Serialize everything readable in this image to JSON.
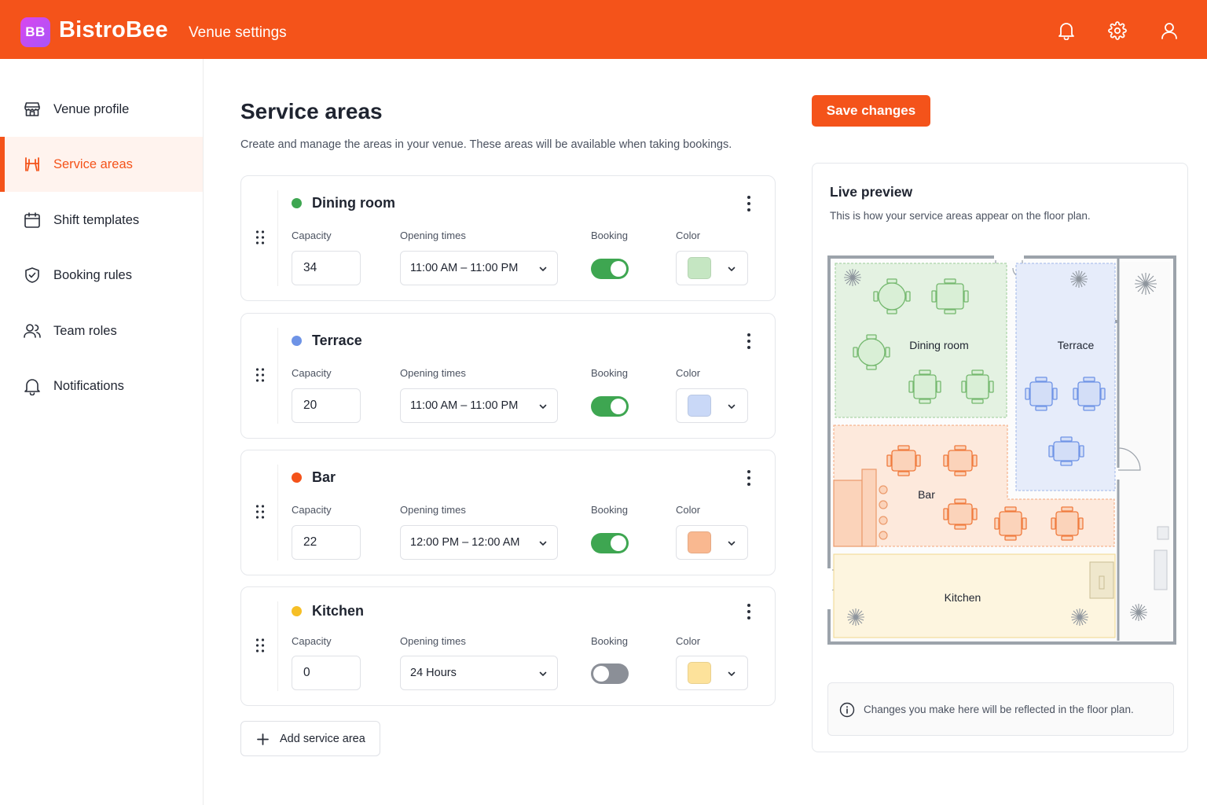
{
  "header": {
    "logo_text": "BB",
    "brand": "BistroBee",
    "section": "Venue settings",
    "icons": [
      "bell-icon",
      "gear-icon",
      "user-icon"
    ],
    "color": "#f4531a"
  },
  "sidebar": {
    "items": [
      {
        "label": "Venue profile",
        "icon": "storefront-icon",
        "active": false
      },
      {
        "label": "Service areas",
        "icon": "service-areas-icon",
        "active": true
      },
      {
        "label": "Shift templates",
        "icon": "calendar-icon",
        "active": false
      },
      {
        "label": "Booking rules",
        "icon": "shield-check-icon",
        "active": false
      },
      {
        "label": "Team roles",
        "icon": "users-icon",
        "active": false
      },
      {
        "label": "Notifications",
        "icon": "bell-icon",
        "active": false
      }
    ]
  },
  "main": {
    "title": "Service areas",
    "description": "Create and manage the areas in your venue. These areas will be available when taking bookings.",
    "save_label": "Save changes",
    "add_label": "Add service area",
    "field_labels": {
      "capacity": "Capacity",
      "opening": "Opening times",
      "booking": "Booking",
      "color": "Color"
    },
    "areas": [
      {
        "name": "Dining room",
        "dot": "#3ea651",
        "capacity": "34",
        "opening": "11:00 AM – 11:00 PM",
        "booking": true,
        "swatch": "#c5e6c2"
      },
      {
        "name": "Terrace",
        "dot": "#6e93e6",
        "capacity": "20",
        "opening": "11:00 AM – 11:00 PM",
        "booking": true,
        "swatch": "#c9d8f7"
      },
      {
        "name": "Bar",
        "dot": "#f4531a",
        "capacity": "22",
        "opening": "12:00 PM – 12:00 AM",
        "booking": true,
        "swatch": "#f9b890"
      },
      {
        "name": "Kitchen",
        "dot": "#f6bf26",
        "capacity": "0",
        "opening": "24 Hours",
        "booking": false,
        "swatch": "#fde29b"
      }
    ]
  },
  "preview": {
    "title": "Live preview",
    "description": "This is how your service areas appear on the floor plan.",
    "labels": {
      "dining": "Dining room",
      "terrace": "Terrace",
      "bar": "Bar",
      "kitchen": "Kitchen"
    },
    "note": "Changes you make here will be reflected in the floor plan."
  }
}
